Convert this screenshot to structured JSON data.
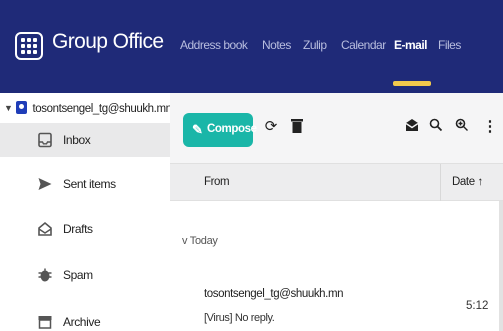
{
  "app": {
    "name": "Group Office",
    "logo_icon": "apps-grid-icon",
    "colors": {
      "topbar": "#1f2a78",
      "accent": "#1ab6a8",
      "active_tab_underline": "#f2c94c",
      "account_icon": "#1f3db8"
    }
  },
  "nav": {
    "items": [
      {
        "label": "Address book"
      },
      {
        "label": "Notes"
      },
      {
        "label": "Zulip"
      },
      {
        "label": "Calendar"
      },
      {
        "label": "E-mail",
        "active": true
      },
      {
        "label": "Files"
      }
    ]
  },
  "sidebar": {
    "account": "tosontsengel_tg@shuukh.mn",
    "folders": [
      {
        "label": "Inbox",
        "icon": "inbox-icon",
        "selected": true
      },
      {
        "label": "Sent items",
        "icon": "send-icon"
      },
      {
        "label": "Drafts",
        "icon": "drafts-icon"
      },
      {
        "label": "Spam",
        "icon": "spam-icon"
      },
      {
        "label": "Archive",
        "icon": "archive-icon"
      }
    ]
  },
  "toolbar": {
    "compose_label": "Compose",
    "icons": [
      "refresh-icon",
      "trash-icon",
      "mark-read-icon",
      "search-icon",
      "search-advanced-icon",
      "more-vertical-icon"
    ]
  },
  "list": {
    "columns": {
      "from": "From",
      "date": "Date ↑"
    },
    "group": "Today",
    "messages": [
      {
        "from": "tosontsengel_tg@shuukh.mn",
        "subject": "[Virus] No reply.",
        "time": "5:12"
      }
    ]
  }
}
